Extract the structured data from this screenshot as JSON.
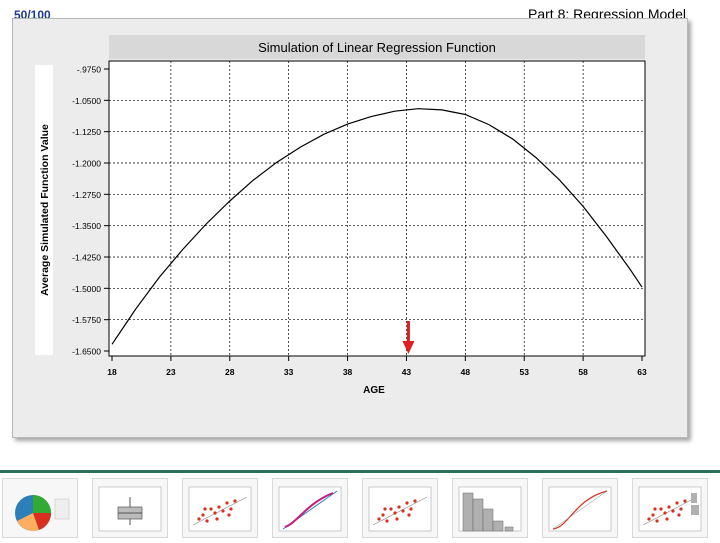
{
  "slide": {
    "number": "50/100",
    "title": "Part 8: Regression Model"
  },
  "colors": {
    "frame_bg": "#ececec",
    "title_bar": "#d8d8d8",
    "curve": "#000000",
    "arrow": "#e02020",
    "strip": "#2f6f5e"
  },
  "chart_data": {
    "type": "line",
    "title": "Simulation of Linear Regression Function",
    "xlabel": "AGE",
    "ylabel": "Average Simulated Function Value",
    "xlim": [
      18,
      63
    ],
    "ylim": [
      -1.65,
      -0.975
    ],
    "xticks": [
      "18",
      "23",
      "28",
      "33",
      "38",
      "43",
      "48",
      "53",
      "58",
      "63"
    ],
    "yticks": [
      "-.9750",
      "-1.0500",
      "-1.1250",
      "-1.2000",
      "-1.2750",
      "-1.3500",
      "-1.4250",
      "-1.5000",
      "-1.5750",
      "-1.6500"
    ],
    "grid": true,
    "series": [
      {
        "x": [
          18,
          20,
          22,
          24,
          26,
          28,
          30,
          32,
          34,
          36,
          38,
          40,
          42,
          44,
          46,
          48,
          50,
          52,
          54,
          56,
          58,
          60,
          62,
          63
        ],
        "values": [
          -1.634,
          -1.55,
          -1.474,
          -1.407,
          -1.346,
          -1.291,
          -1.241,
          -1.198,
          -1.162,
          -1.131,
          -1.107,
          -1.089,
          -1.076,
          -1.07,
          -1.073,
          -1.084,
          -1.108,
          -1.142,
          -1.187,
          -1.241,
          -1.304,
          -1.377,
          -1.455,
          -1.497
        ]
      }
    ],
    "annotation": {
      "type": "arrow",
      "x": 43,
      "color": "#e02020"
    }
  },
  "thumbnails": [
    {
      "kind": "pie"
    },
    {
      "kind": "box"
    },
    {
      "kind": "scatter"
    },
    {
      "kind": "prob"
    },
    {
      "kind": "scatter"
    },
    {
      "kind": "hist"
    },
    {
      "kind": "curve"
    },
    {
      "kind": "scatter-hist"
    }
  ]
}
